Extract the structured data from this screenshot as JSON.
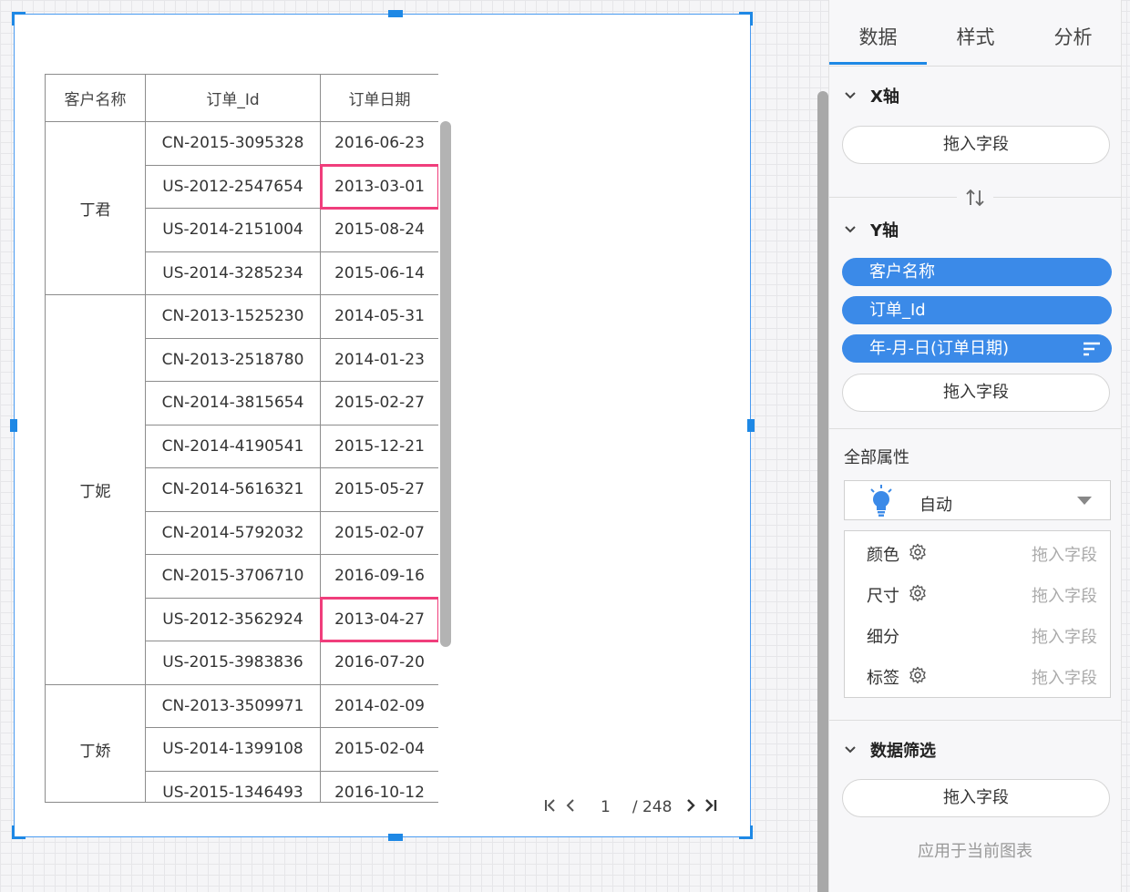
{
  "table": {
    "headers": [
      "客户名称",
      "订单_Id",
      "订单日期"
    ],
    "groups": [
      {
        "customer": "丁君",
        "rows": [
          {
            "id": "CN-2015-3095328",
            "date": "2016-06-23"
          },
          {
            "id": "US-2012-2547654",
            "date": "2013-03-01",
            "highlight": true
          },
          {
            "id": "US-2014-2151004",
            "date": "2015-08-24"
          },
          {
            "id": "US-2014-3285234",
            "date": "2015-06-14"
          }
        ]
      },
      {
        "customer": "丁妮",
        "rows": [
          {
            "id": "CN-2013-1525230",
            "date": "2014-05-31"
          },
          {
            "id": "CN-2013-2518780",
            "date": "2014-01-23"
          },
          {
            "id": "CN-2014-3815654",
            "date": "2015-02-27"
          },
          {
            "id": "CN-2014-4190541",
            "date": "2015-12-21"
          },
          {
            "id": "CN-2014-5616321",
            "date": "2015-05-27"
          },
          {
            "id": "CN-2014-5792032",
            "date": "2015-02-07"
          },
          {
            "id": "CN-2015-3706710",
            "date": "2016-09-16"
          },
          {
            "id": "US-2012-3562924",
            "date": "2013-04-27",
            "highlight": true
          },
          {
            "id": "US-2015-3983836",
            "date": "2016-07-20"
          }
        ]
      },
      {
        "customer": "丁娇",
        "rows": [
          {
            "id": "CN-2013-3509971",
            "date": "2014-02-09"
          },
          {
            "id": "US-2014-1399108",
            "date": "2015-02-04"
          },
          {
            "id": "US-2015-1346493",
            "date": "2016-10-12"
          }
        ]
      }
    ]
  },
  "pager": {
    "current_page": "1",
    "total": "/ 248"
  },
  "panel": {
    "tabs": [
      "数据",
      "样式",
      "分析"
    ],
    "active_tab": 0,
    "x_axis": {
      "title": "X轴",
      "drop_label": "拖入字段"
    },
    "y_axis": {
      "title": "Y轴",
      "fields": [
        "客户名称",
        "订单_Id",
        "年-月-日(订单日期)"
      ],
      "drop_label": "拖入字段"
    },
    "all_props": {
      "title": "全部属性",
      "mark_type": "自动",
      "marks": [
        {
          "name": "颜色",
          "gear": true,
          "slot": "拖入字段"
        },
        {
          "name": "尺寸",
          "gear": true,
          "slot": "拖入字段"
        },
        {
          "name": "细分",
          "gear": false,
          "slot": "拖入字段"
        },
        {
          "name": "标签",
          "gear": true,
          "slot": "拖入字段"
        }
      ]
    },
    "filter": {
      "title": "数据筛选",
      "drop_label": "拖入字段",
      "apply_label": "应用于当前图表"
    }
  },
  "colors": {
    "accent": "#1e88e5",
    "pill": "#3b8ae8",
    "highlight": "#f03e7c"
  }
}
